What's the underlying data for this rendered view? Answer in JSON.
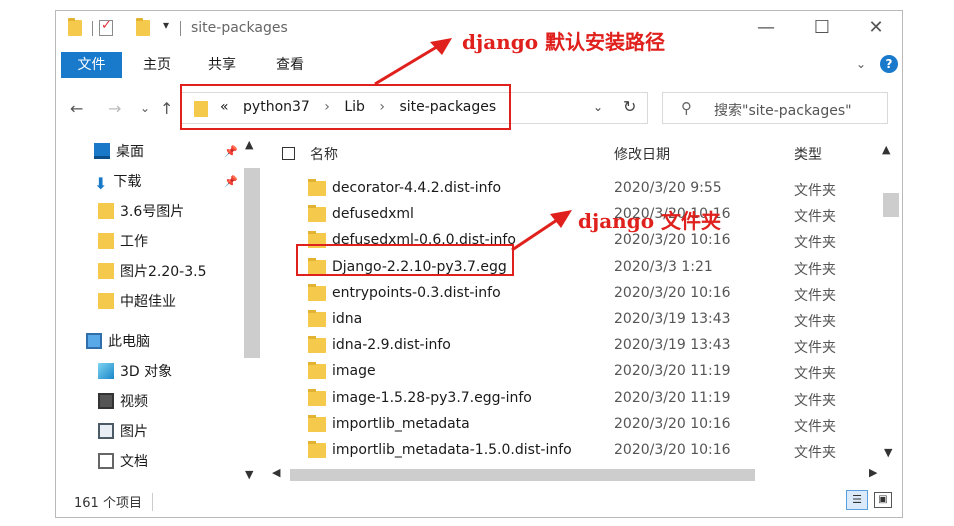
{
  "window": {
    "title": "site-packages",
    "qa_dropdown": "▾",
    "minimize": "—",
    "maximize": "☐",
    "close": "✕"
  },
  "ribbon": {
    "file_tab": "文件",
    "tabs": [
      "主页",
      "共享",
      "查看"
    ],
    "expand": "⌄",
    "help": "?"
  },
  "nav": {
    "back": "←",
    "forward": "→",
    "recent": "⌄",
    "up": "↑",
    "overflow": "«",
    "breadcrumb": [
      "python37",
      "Lib",
      "site-packages"
    ],
    "crumb_sep": "›",
    "dropdown": "⌄",
    "refresh": "↻",
    "search_placeholder": "搜索\"site-packages\""
  },
  "annotations": {
    "install_path": "django 默认安装路径",
    "django_folder": "django 文件夹"
  },
  "sidebar": {
    "items": [
      {
        "label": "桌面",
        "icon": "desktop-icon",
        "pinned": true
      },
      {
        "label": "下载",
        "icon": "download-icon",
        "pinned": true
      },
      {
        "label": "3.6号图片",
        "icon": "folder-icon"
      },
      {
        "label": "工作",
        "icon": "folder-icon"
      },
      {
        "label": "图片2.20-3.5",
        "icon": "folder-icon"
      },
      {
        "label": "中超佳业",
        "icon": "folder-icon"
      },
      {
        "label": "此电脑",
        "icon": "computer-icon"
      },
      {
        "label": "3D 对象",
        "icon": "3d-objects-icon"
      },
      {
        "label": "视频",
        "icon": "video-icon"
      },
      {
        "label": "图片",
        "icon": "pictures-icon"
      },
      {
        "label": "文档",
        "icon": "documents-icon"
      }
    ],
    "pin_glyph": "📌"
  },
  "filelist": {
    "columns": [
      "名称",
      "修改日期",
      "类型"
    ],
    "rows": [
      {
        "name": "decorator-4.4.2.dist-info",
        "date": "2020/3/20 9:55",
        "type": "文件夹"
      },
      {
        "name": "defusedxml",
        "date": "2020/3/20 10:16",
        "type": "文件夹"
      },
      {
        "name": "defusedxml-0.6.0.dist-info",
        "date": "2020/3/20 10:16",
        "type": "文件夹"
      },
      {
        "name": "Django-2.2.10-py3.7.egg",
        "date": "2020/3/3 1:21",
        "type": "文件夹"
      },
      {
        "name": "entrypoints-0.3.dist-info",
        "date": "2020/3/20 10:16",
        "type": "文件夹"
      },
      {
        "name": "idna",
        "date": "2020/3/19 13:43",
        "type": "文件夹"
      },
      {
        "name": "idna-2.9.dist-info",
        "date": "2020/3/19 13:43",
        "type": "文件夹"
      },
      {
        "name": "image",
        "date": "2020/3/20 11:19",
        "type": "文件夹"
      },
      {
        "name": "image-1.5.28-py3.7.egg-info",
        "date": "2020/3/20 11:19",
        "type": "文件夹"
      },
      {
        "name": "importlib_metadata",
        "date": "2020/3/20 10:16",
        "type": "文件夹"
      },
      {
        "name": "importlib_metadata-1.5.0.dist-info",
        "date": "2020/3/20 10:16",
        "type": "文件夹"
      }
    ]
  },
  "status": {
    "item_count": "161 个项目"
  },
  "colors": {
    "accent": "#1979ca",
    "annotation": "#e0201c",
    "folder": "#f4c94c"
  }
}
